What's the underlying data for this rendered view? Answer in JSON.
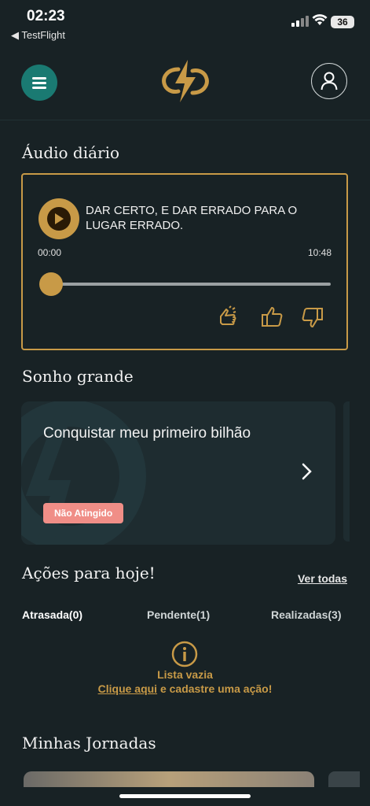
{
  "status_bar": {
    "time": "02:23",
    "back_app": "◀ TestFlight",
    "battery": "36"
  },
  "header": {
    "menu_icon": "hamburger-icon",
    "logo_icon": "lightning-logo",
    "profile_icon": "user-icon"
  },
  "audio": {
    "section_title": "Áudio diário",
    "track_title": "DAR CERTO, E DAR ERRADO PARA O LUGAR ERRADO.",
    "time_current": "00:00",
    "time_total": "10:48",
    "progress": 0.0,
    "accent": "#c89a47"
  },
  "dream": {
    "section_title": "Sonho grande",
    "text": "Conquistar meu primeiro bilhão",
    "badge": "Não Atingido",
    "badge_color": "#f08e87"
  },
  "actions": {
    "section_title": "Ações para hoje!",
    "see_all": "Ver todas",
    "tabs": [
      "Atrasada(0)",
      "Pendente(1)",
      "Realizadas(3)"
    ],
    "empty_label": "Lista vazia",
    "empty_link": "Clique aqui",
    "empty_rest": " e cadastre uma ação!"
  },
  "journeys": {
    "section_title": "Minhas Jornadas"
  }
}
